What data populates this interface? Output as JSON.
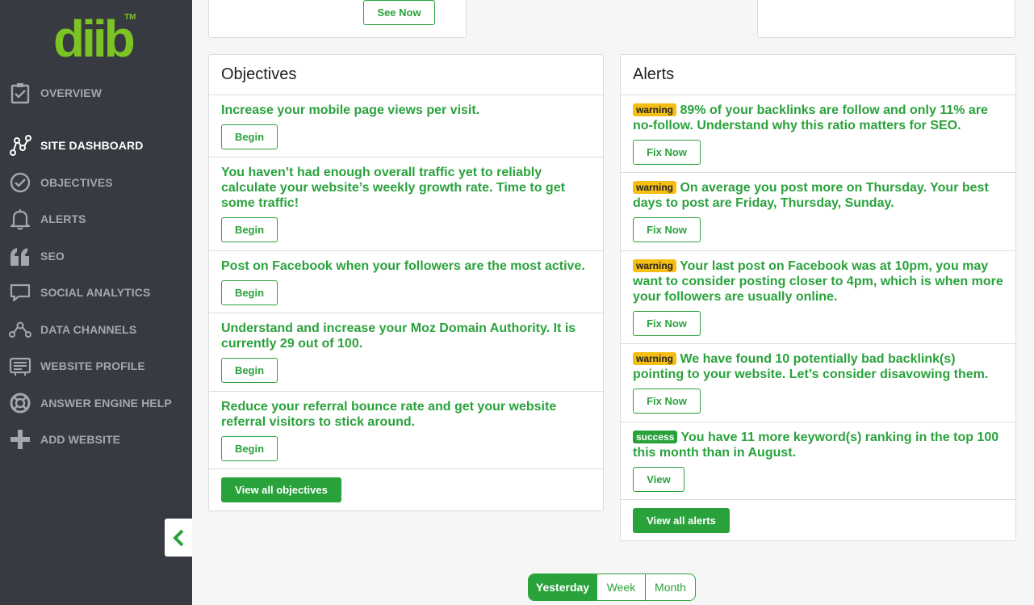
{
  "brand": {
    "logo_text": "diib",
    "trademark": "TM"
  },
  "sidebar": {
    "items": [
      {
        "label": "OVERVIEW",
        "icon": "clipboard-check-icon"
      },
      {
        "label": "SITE DASHBOARD",
        "icon": "graph-nodes-icon",
        "active": true
      },
      {
        "label": "OBJECTIVES",
        "icon": "check-circle-icon"
      },
      {
        "label": "ALERTS",
        "icon": "bell-icon"
      },
      {
        "label": "SEO",
        "icon": "quote-icon"
      },
      {
        "label": "SOCIAL ANALYTICS",
        "icon": "chat-bubble-icon"
      },
      {
        "label": "DATA CHANNELS",
        "icon": "network-icon"
      },
      {
        "label": "WEBSITE PROFILE",
        "icon": "id-card-icon"
      },
      {
        "label": "ANSWER ENGINE HELP",
        "icon": "lifebuoy-icon"
      },
      {
        "label": "ADD WEBSITE",
        "icon": "plus-icon"
      }
    ]
  },
  "top_card": {
    "see_now_label": "See Now"
  },
  "objectives": {
    "title": "Objectives",
    "items": [
      {
        "text": "Increase your mobile page views per visit.",
        "button": "Begin"
      },
      {
        "text": "You haven’t had enough overall traffic yet to reliably calculate your website’s weekly growth rate. Time to get some traffic!",
        "button": "Begin"
      },
      {
        "text": "Post on Facebook when your followers are the most active.",
        "button": "Begin"
      },
      {
        "text": "Understand and increase your Moz Domain Authority. It is currently 29 out of 100.",
        "button": "Begin"
      },
      {
        "text": "Reduce your referral bounce rate and get your website referral visitors to stick around.",
        "button": "Begin"
      }
    ],
    "view_all_label": "View all objectives"
  },
  "alerts": {
    "title": "Alerts",
    "items": [
      {
        "badge": "warning",
        "text": "89% of your backlinks are follow and only 11% are no-follow. Understand why this ratio matters for SEO.",
        "button": "Fix Now"
      },
      {
        "badge": "warning",
        "text": "On average you post more on Thursday. Your best days to post are Friday, Thursday, Sunday.",
        "button": "Fix Now"
      },
      {
        "badge": "warning",
        "text": "Your last post on Facebook was at 10pm, you may want to consider posting closer to 4pm, which is when more your followers are usually online.",
        "button": "Fix Now"
      },
      {
        "badge": "warning",
        "text": "We have found 10 potentially bad backlink(s) pointing to your website. Let’s consider disavowing them.",
        "button": "Fix Now"
      },
      {
        "badge": "success",
        "text": "You have 11 more keyword(s) ranking in the top 100 this month than in August.",
        "button": "View"
      }
    ],
    "view_all_label": "View all alerts"
  },
  "period_selector": {
    "options": [
      "Yesterday",
      "Week",
      "Month"
    ],
    "selected": "Yesterday"
  },
  "colors": {
    "sidebar_bg": "#373a40",
    "accent_green": "#2aa23c",
    "logo_green": "#7cc424",
    "warning": "#f5be14"
  }
}
